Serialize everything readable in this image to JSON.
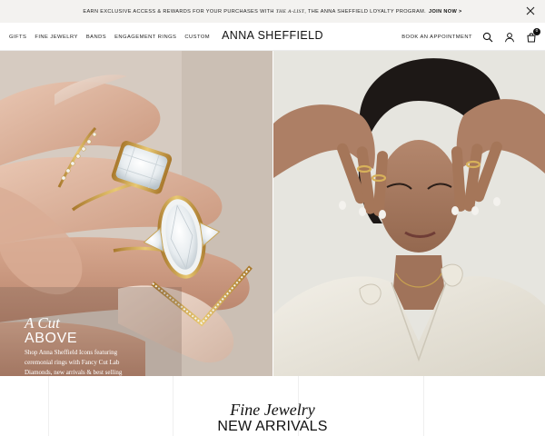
{
  "announcement": {
    "text_before": "EARN EXCLUSIVE ACCESS & REWARDS FOR YOUR PURCHASES WITH ",
    "text_italic": "THE A-LIST",
    "text_after": ", THE ANNA SHEFFIELD LOYALTY PROGRAM.",
    "cta": "JOIN NOW >"
  },
  "header": {
    "logo": "ANNA SHEFFIELD",
    "nav_left": [
      "GIFTS",
      "FINE JEWELRY",
      "BANDS",
      "ENGAGEMENT RINGS",
      "CUSTOM"
    ],
    "book_appointment": "BOOK AN APPOINTMENT",
    "cart_count": "0"
  },
  "hero": {
    "heading_italic": "A Cut",
    "heading_caps": "ABOVE",
    "body": "Shop Anna Sheffield Icons featuring ceremonial rings with Fancy Cut Lab Diamonds, new arrivals & best selling"
  },
  "section": {
    "title_italic": "Fine Jewelry",
    "title_caps": "NEW ARRIVALS"
  },
  "colors": {
    "announcement_bg": "#f3f2f0",
    "text": "#111111",
    "gold": "#d7b15a",
    "background": "#ffffff"
  }
}
